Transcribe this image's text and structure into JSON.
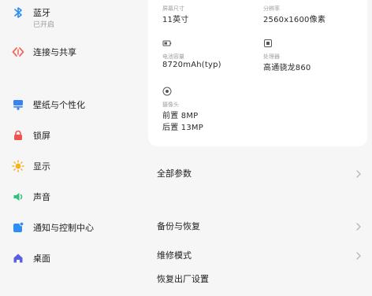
{
  "sidebar": {
    "bluetooth": {
      "label": "蓝牙",
      "status": "已开启"
    },
    "items": [
      {
        "label": "连接与共享"
      },
      {
        "label": "壁纸与个性化"
      },
      {
        "label": "锁屏"
      },
      {
        "label": "显示"
      },
      {
        "label": "声音"
      },
      {
        "label": "通知与控制中心"
      },
      {
        "label": "桌面"
      }
    ]
  },
  "specs": {
    "screen_size": {
      "label": "屏幕尺寸",
      "value": "11英寸"
    },
    "resolution": {
      "label": "分辨率",
      "value": "2560x1600像素"
    },
    "battery": {
      "label": "电池容量",
      "value": "8720mAh(typ)"
    },
    "processor": {
      "label": "处理器",
      "value": "高通骁龙860"
    },
    "camera": {
      "label": "摄像头",
      "front": "前置 8MP",
      "rear": "后置 13MP"
    }
  },
  "rows": {
    "all_params": "全部参数",
    "backup": "备份与恢复",
    "repair_mode": "维修模式",
    "factory_reset": "恢复出厂设置"
  },
  "colors": {
    "bluetooth": "#2a8cf0",
    "connection": "#f06a5e",
    "wallpaper": "#3a84f2",
    "lockscreen": "#f0524e",
    "display": "#f5b21a",
    "sound": "#2fc27a",
    "notification": "#2f8ef5",
    "home": "#5a5fe0"
  }
}
